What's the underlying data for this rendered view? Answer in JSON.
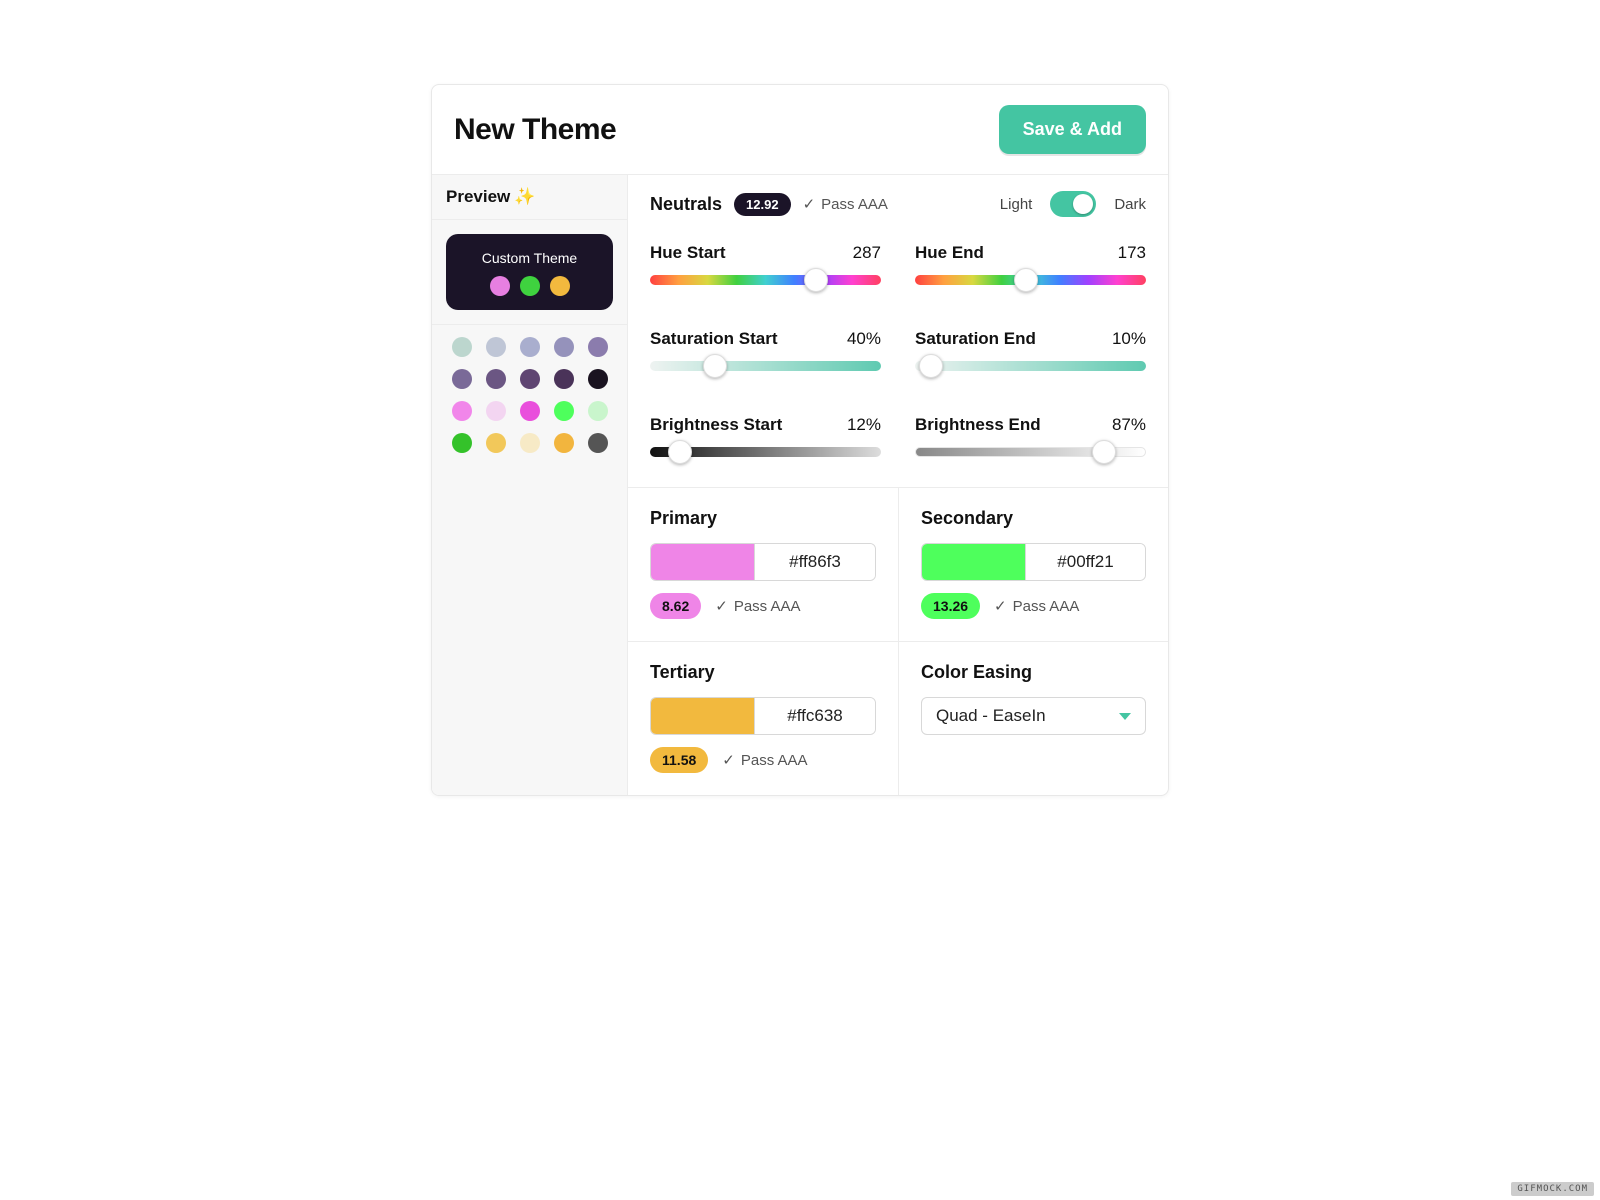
{
  "header": {
    "title": "New Theme",
    "save_label": "Save & Add"
  },
  "sidebar": {
    "preview_label": "Preview",
    "card_title": "Custom Theme",
    "card_dots": [
      "#e77fe1",
      "#3fd23f",
      "#f2b93e"
    ],
    "swatches": [
      "#bcd6ce",
      "#bfc6d6",
      "#a9aece",
      "#9592bb",
      "#8b7cad",
      "#7a6a98",
      "#6b5683",
      "#5f4572",
      "#4a3359",
      "#1a1320",
      "#f186ea",
      "#f3d5f1",
      "#e94fdc",
      "#4eff5c",
      "#c9f5cc",
      "#34c22a",
      "#f2c85a",
      "#f7eac6",
      "#f2b53e",
      "#555555"
    ]
  },
  "neutrals": {
    "label": "Neutrals",
    "score": "12.92",
    "pass": "Pass AAA",
    "mode_light": "Light",
    "mode_dark": "Dark"
  },
  "sliders": {
    "hue_start": {
      "label": "Hue Start",
      "value": "287",
      "pct": 72
    },
    "hue_end": {
      "label": "Hue End",
      "value": "173",
      "pct": 48
    },
    "sat_start": {
      "label": "Saturation Start",
      "value": "40%",
      "pct": 28
    },
    "sat_end": {
      "label": "Saturation End",
      "value": "10%",
      "pct": 7
    },
    "bri_start": {
      "label": "Brightness Start",
      "value": "12%",
      "pct": 13
    },
    "bri_end": {
      "label": "Brightness End",
      "value": "87%",
      "pct": 82
    }
  },
  "colors": {
    "primary": {
      "label": "Primary",
      "hex": "#ff86f3",
      "swatch": "#ef85e7",
      "score": "8.62",
      "pass": "Pass AAA"
    },
    "secondary": {
      "label": "Secondary",
      "hex": "#00ff21",
      "swatch": "#4eff5c",
      "score": "13.26",
      "pass": "Pass AAA"
    },
    "tertiary": {
      "label": "Tertiary",
      "hex": "#ffc638",
      "swatch": "#f2b93e",
      "score": "11.58",
      "pass": "Pass AAA"
    }
  },
  "easing": {
    "label": "Color Easing",
    "value": "Quad - EaseIn"
  },
  "watermark": "GIFMOCK.COM"
}
